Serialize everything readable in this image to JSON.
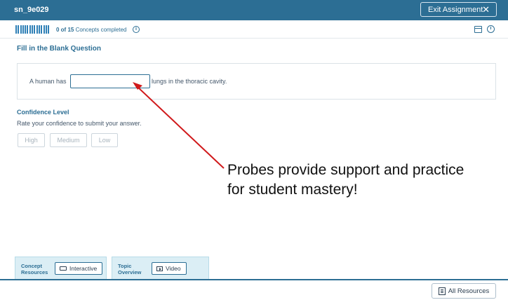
{
  "header": {
    "assignment_id": "sn_9e029",
    "exit_label": "Exit Assignment",
    "exit_icon": "close-icon"
  },
  "progress": {
    "completed": "0 of 15",
    "suffix": "Concepts completed",
    "total_concepts": 15,
    "completed_count": 0,
    "info_icon": "info-icon",
    "calendar_icon": "calendar-icon",
    "clock_icon": "clock-icon"
  },
  "question": {
    "title": "Fill in the Blank Question",
    "prefix": "A human has",
    "answer_value": "",
    "suffix": "lungs in the thoracic cavity."
  },
  "confidence": {
    "title": "Confidence Level",
    "subtitle": "Rate your confidence to submit your answer.",
    "options": [
      "High",
      "Medium",
      "Low"
    ]
  },
  "annotation": {
    "line1": "Probes provide support and practice",
    "line2": "for student mastery!",
    "arrow_color": "#d0191b"
  },
  "resources": {
    "tabs": [
      {
        "label_line1": "Concept",
        "label_line2": "Resources",
        "button": "Interactive"
      },
      {
        "label_line1": "Topic",
        "label_line2": "Overview",
        "button": "Video"
      }
    ],
    "all_resources": "All Resources"
  },
  "colors": {
    "primary": "#2c6e94",
    "progress_fill": "#2f80b6",
    "tab_bg": "#dbeef5"
  }
}
